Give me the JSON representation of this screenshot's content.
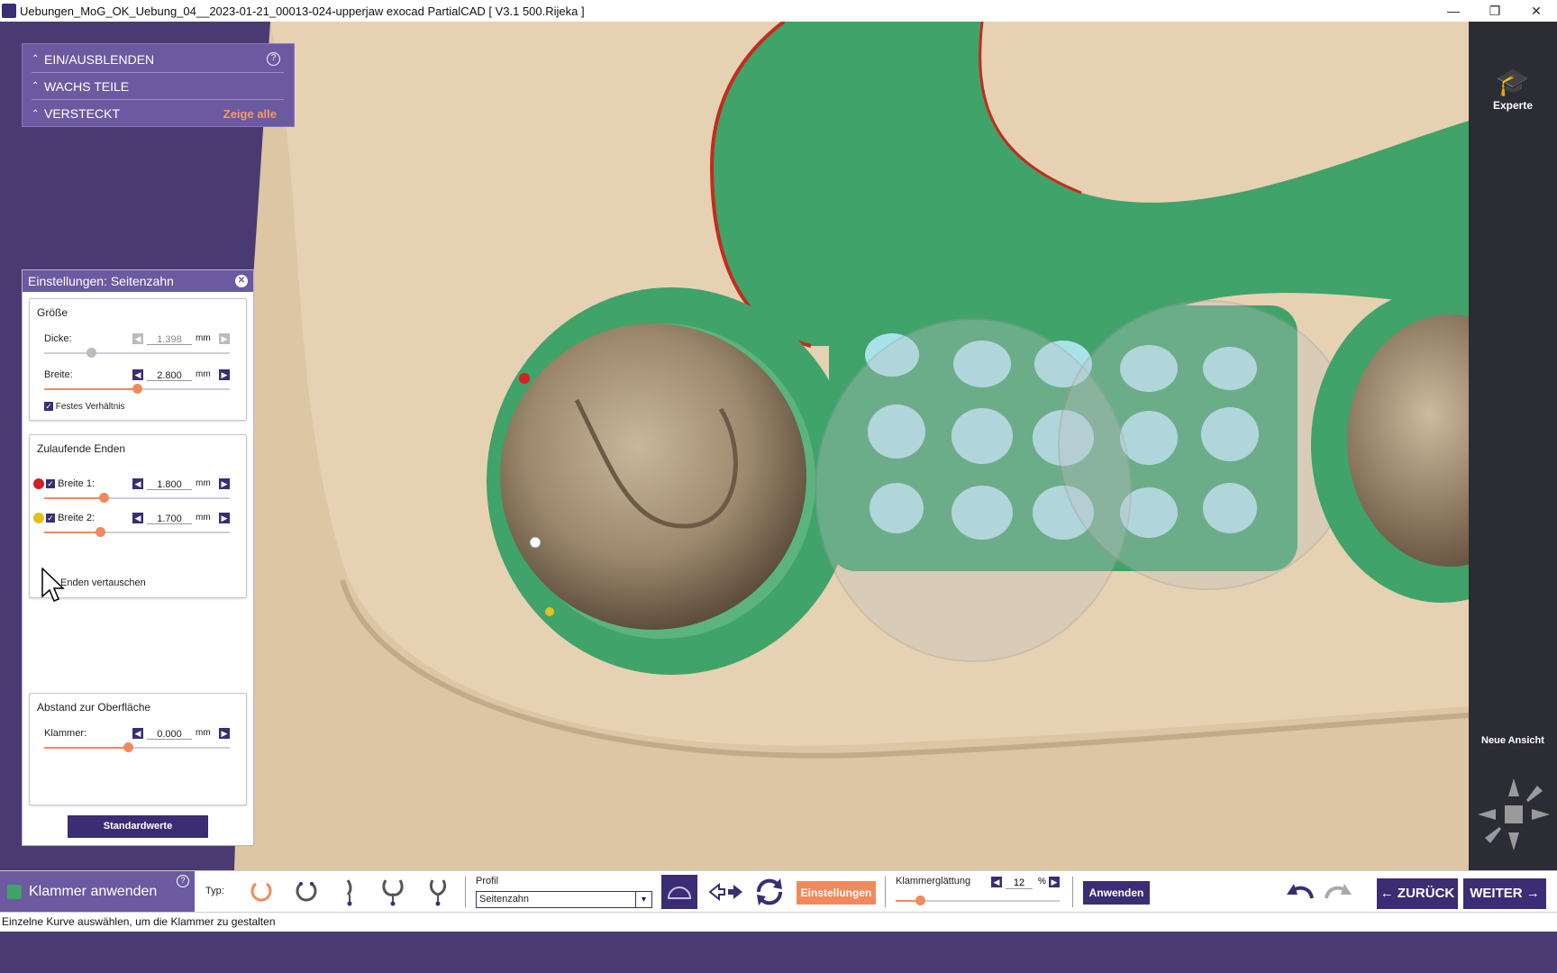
{
  "window": {
    "title": "Uebungen_MoG_OK_Uebung_04__2023-01-21_00013-024-upperjaw exocad PartialCAD [ V3.1 500.Rijeka ]",
    "minimize": "—",
    "maximize": "❐",
    "close": "✕"
  },
  "top_panel": {
    "items": [
      {
        "label": "EIN/AUSBLENDEN"
      },
      {
        "label": "WACHS TEILE"
      },
      {
        "label": "VERSTECKT"
      }
    ],
    "help": "?",
    "show_all": "Zeige alle"
  },
  "settings": {
    "title": "Einstellungen: Seitenzahn",
    "close": "✕",
    "size_group": {
      "title": "Größe",
      "thickness": {
        "label": "Dicke:",
        "value": "1.398",
        "unit": "mm",
        "fraction": 0.25,
        "enabled": false
      },
      "width": {
        "label": "Breite:",
        "value": "2.800",
        "unit": "mm",
        "fraction": 0.5,
        "enabled": true
      },
      "fixed_ratio": {
        "label": "Festes Verhältnis",
        "checked": true
      }
    },
    "tapered_group": {
      "title": "Zulaufende Enden",
      "width1": {
        "label": "Breite 1:",
        "value": "1.800",
        "unit": "mm",
        "fraction": 0.32,
        "marker_color": "#d42020"
      },
      "width2": {
        "label": "Breite 2:",
        "value": "1.700",
        "unit": "mm",
        "fraction": 0.3,
        "marker_color": "#e0c21a"
      },
      "swap_ends": "Enden vertauschen"
    },
    "distance_group": {
      "title": "Abstand zur Oberfläche",
      "clasp": {
        "label": "Klammer:",
        "value": "0.000",
        "unit": "mm",
        "fraction": 0.45
      }
    },
    "defaults_button": "Standardwerte"
  },
  "sidebar": {
    "expert_label": "Experte",
    "new_view_label": "Neue Ansicht"
  },
  "toolbar": {
    "title": "Klammer anwenden",
    "help": "?",
    "type_label": "Typ:",
    "profile_label": "Profil",
    "profile_value": "Seitenzahn",
    "settings_button": "Einstellungen",
    "smoothing_label": "Klammerglättung",
    "smoothing_value": "12",
    "smoothing_unit": "%",
    "smoothing_fraction": 0.15,
    "apply_button": "Anwenden",
    "back_button": "ZURÜCK",
    "next_button": "WEITER"
  },
  "status": {
    "text": "Einzelne Kurve auswählen, um die Klammer zu gestalten"
  },
  "colors": {
    "accent": "#3b2d73",
    "panel": "#6b5aa0",
    "orange": "#f08a5d",
    "frame_green": "#3fa36a",
    "gum": "#e6d2b2"
  }
}
